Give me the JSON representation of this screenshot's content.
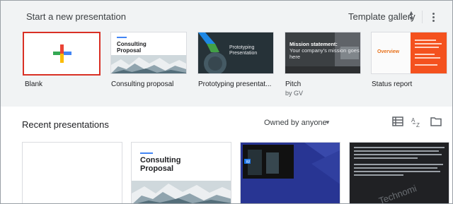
{
  "gallery": {
    "title": "Start a new presentation",
    "template_gallery_label": "Template gallery",
    "templates": [
      {
        "label": "Blank",
        "sub": ""
      },
      {
        "label": "Consulting proposal",
        "sub": "",
        "thumb_title": "Consulting Proposal"
      },
      {
        "label": "Prototyping presentat...",
        "sub": "",
        "thumb_title": "Prototyping Presentation"
      },
      {
        "label": "Pitch",
        "sub": "by GV",
        "thumb_title": "Mission statement:",
        "thumb_body": "Your company's mission goes here"
      },
      {
        "label": "Status report",
        "sub": "",
        "thumb_title": "Overview"
      }
    ]
  },
  "recent": {
    "title": "Recent presentations",
    "owner_filter": "Owned by anyone",
    "items": [
      {
        "thumb_title": ""
      },
      {
        "thumb_title": "Consulting Proposal"
      },
      {
        "thumb_title": ""
      },
      {
        "thumb_title": "Technomi"
      }
    ]
  },
  "colors": {
    "selected_outline": "#d93025",
    "gallery_bg": "#f1f3f4",
    "status_accent": "#f4511e",
    "blue_slide": "#283593"
  },
  "icons": [
    "unfold-icon",
    "more-vert-icon",
    "list-view-icon",
    "sort-az-icon",
    "folder-icon"
  ]
}
